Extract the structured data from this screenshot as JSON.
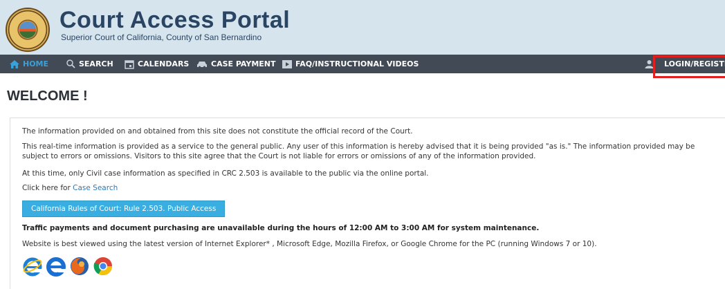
{
  "header": {
    "title": "Court Access Portal",
    "subtitle": "Superior Court of California, County of San Bernardino"
  },
  "nav": {
    "home": "HOME",
    "search": "SEARCH",
    "calendars": "CALENDARS",
    "case_payment": "CASE PAYMENT",
    "faq": "FAQ/INSTRUCTIONAL VIDEOS",
    "login": "LOGIN/REGISTER"
  },
  "main": {
    "welcome": "WELCOME !",
    "p1": "The information provided on and obtained from this site does not constitute the official record of the Court.",
    "p2": "This real-time information is provided as a service to the general public. Any user of this information is hereby advised that it is being provided \"as is.\" The information provided may be subject to errors or omissions. Visitors to this site agree that the Court is not liable for errors or omissions of any of the information provided.",
    "p3": "At this time, only Civil case information as specified in CRC 2.503 is available to the public via the online portal.",
    "click_prefix": "Click here for ",
    "case_search_link": "Case Search",
    "rule_button": "California Rules of Court: Rule 2.503. Public Access",
    "maintenance": "Traffic payments and document purchasing are unavailable during the hours of 12:00 AM to 3:00 AM for system maintenance.",
    "browser_note": "Website is best viewed using the latest version of Internet Explorer* , Microsoft Edge, Mozilla Firefox, or Google Chrome for the PC (running Windows 7 or 10)."
  },
  "colors": {
    "header_bg": "#d6e4ee",
    "nav_bg": "#414a55",
    "accent": "#3aa0d8",
    "button": "#3aaee0",
    "highlight": "#e02020"
  },
  "icons": [
    "home-icon",
    "search-icon",
    "calendar-icon",
    "car-icon",
    "video-icon",
    "user-icon",
    "internet-explorer-icon",
    "edge-icon",
    "firefox-icon",
    "chrome-icon"
  ]
}
